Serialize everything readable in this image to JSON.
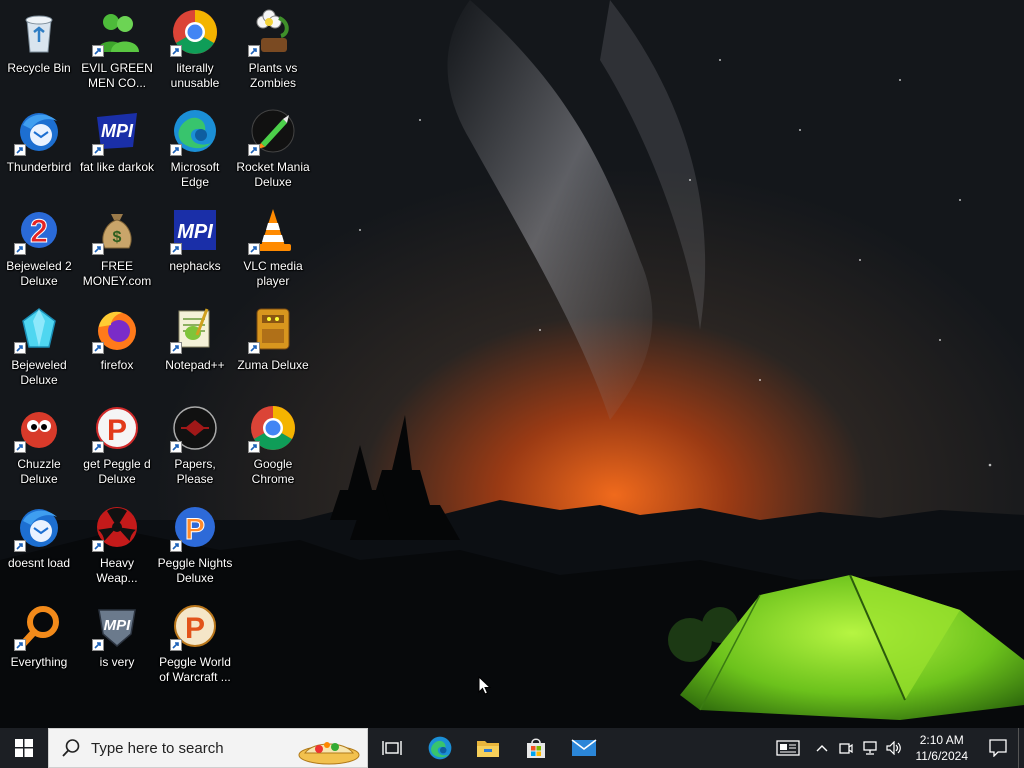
{
  "desktop": {
    "icons": [
      {
        "name": "recycle-bin-icon",
        "label": "Recycle Bin"
      },
      {
        "name": "evil-green-men-icon",
        "label": "EVIL GREEN\nMEN CO..."
      },
      {
        "name": "chrome-icon",
        "label": "literally\nunusable"
      },
      {
        "name": "plants-vs-zombies-icon",
        "label": "Plants vs\nZombies"
      },
      {
        "name": "thunderbird-icon",
        "label": "Thunderbird"
      },
      {
        "name": "mpi-icon",
        "label": "fat like darkok"
      },
      {
        "name": "edge-icon",
        "label": "Microsoft\nEdge"
      },
      {
        "name": "rocket-mania-icon",
        "label": "Rocket Mania\nDeluxe"
      },
      {
        "name": "bejeweled-2-icon",
        "label": "Bejeweled 2\nDeluxe"
      },
      {
        "name": "money-bag-icon",
        "label": "FREE\nMONEY.com"
      },
      {
        "name": "mpi-icon",
        "label": "nephacks"
      },
      {
        "name": "vlc-icon",
        "label": "VLC media\nplayer"
      },
      {
        "name": "bejeweled-icon",
        "label": "Bejeweled\nDeluxe"
      },
      {
        "name": "firefox-icon",
        "label": "firefox"
      },
      {
        "name": "notepad-plus-plus-icon",
        "label": "Notepad++"
      },
      {
        "name": "zuma-icon",
        "label": "Zuma Deluxe"
      },
      {
        "name": "chuzzle-icon",
        "label": "Chuzzle\nDeluxe"
      },
      {
        "name": "peggle-icon",
        "label": "get Peggle d\nDeluxe"
      },
      {
        "name": "papers-please-icon",
        "label": "Papers, Please"
      },
      {
        "name": "chrome-icon",
        "label": "Google\nChrome"
      },
      {
        "name": "thunderbird-icon",
        "label": "doesnt load"
      },
      {
        "name": "heavy-weapon-icon",
        "label": "Heavy\nWeap..."
      },
      {
        "name": "peggle-nights-icon",
        "label": "Peggle Nights\nDeluxe"
      },
      {
        "name": "everything-search-icon",
        "label": "Everything"
      },
      {
        "name": "mpi-shield-icon",
        "label": "is very"
      },
      {
        "name": "peggle-world-icon",
        "label": "Peggle World\nof Warcraft ..."
      }
    ]
  },
  "taskbar": {
    "search_placeholder": "Type here to search",
    "pinned": [
      {
        "name": "task-view-icon"
      },
      {
        "name": "edge-icon"
      },
      {
        "name": "file-explorer-icon"
      },
      {
        "name": "microsoft-store-icon"
      },
      {
        "name": "mail-icon"
      }
    ],
    "tray_icons": [
      "news-icon",
      "chevron-up-icon",
      "meet-now-icon",
      "network-icon",
      "volume-icon"
    ],
    "time": "2:10 AM",
    "date": "11/6/2024"
  },
  "colors": {
    "taskbar_bg": "#1c1f24",
    "search_bg": "#f3f3f3",
    "tent_green": "#7ed321",
    "horizon_orange": "#e0661a"
  }
}
